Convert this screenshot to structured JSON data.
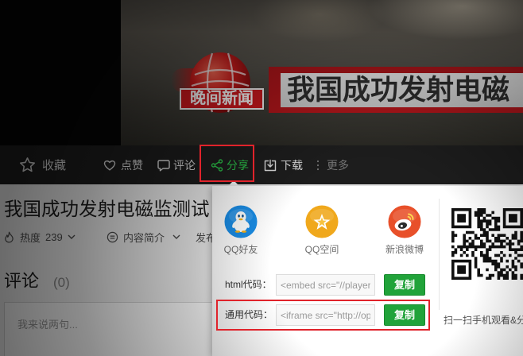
{
  "video": {
    "logo_text": "晚间新闻",
    "banner_text": "我国成功发射电磁"
  },
  "toolbar": {
    "favorite_label": "收藏",
    "like_label": "点赞",
    "comment_label": "评论",
    "share_label": "分享",
    "download_label": "下载",
    "more_label": "更多"
  },
  "video_info": {
    "title": "我国成功发射电磁监测试",
    "heat_label": "热度",
    "heat_value": "239",
    "intro_label": "内容简介",
    "publish_label": "发布"
  },
  "comments": {
    "title": "评论",
    "count": "(0)",
    "input_placeholder": "我来说两句..."
  },
  "share_panel": {
    "platforms": [
      {
        "label": "QQ好友",
        "icon": "qq-penguin-icon",
        "color": "#1a8de6"
      },
      {
        "label": "QQ空间",
        "icon": "qzone-star-icon",
        "color": "#f0a81c"
      },
      {
        "label": "新浪微博",
        "icon": "weibo-icon",
        "color": "#e8502a"
      }
    ],
    "html_code": {
      "label": "html代码：",
      "value": "<embed src=\"//player",
      "copy_label": "复制"
    },
    "general_code": {
      "label": "通用代码：",
      "value": "<iframe src=\"http://op",
      "copy_label": "复制"
    },
    "qr_caption": "扫一扫手机观看&分"
  },
  "colors": {
    "share_active": "#2cc34a",
    "copy_button": "#21a33a",
    "highlight_red": "#e0232b",
    "toolbar_bg": "#1d1d1d"
  }
}
